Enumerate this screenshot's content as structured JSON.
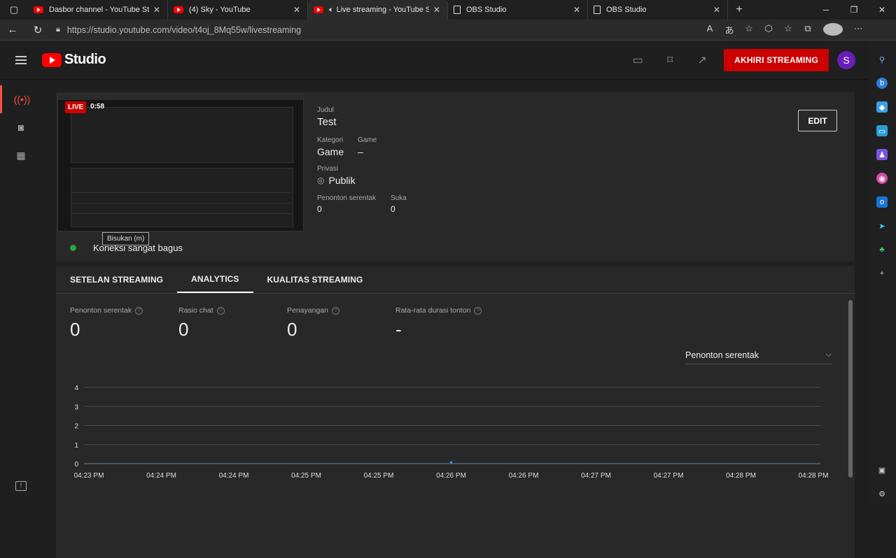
{
  "browser": {
    "tabs": [
      {
        "title": "Dasbor channel - YouTube Studio",
        "icon": "youtube-icon",
        "active": false,
        "audio": false
      },
      {
        "title": "(4) Sky - YouTube",
        "icon": "youtube-icon",
        "active": false,
        "audio": false
      },
      {
        "title": "Live streaming - YouTube Studio",
        "icon": "youtube-icon",
        "active": true,
        "audio": true
      },
      {
        "title": "OBS Studio",
        "icon": "document-icon",
        "active": false,
        "audio": false
      },
      {
        "title": "OBS Studio",
        "icon": "document-icon",
        "active": false,
        "audio": false
      }
    ],
    "url": "https://studio.youtube.com/video/t4oj_8Mq55w/livestreaming"
  },
  "studio": {
    "logo_text": "Studio",
    "end_stream_label": "AKHIRI STREAMING",
    "user_initial": "S",
    "accent": "#cc0000"
  },
  "stream": {
    "live_label": "LIVE",
    "elapsed": "0:58",
    "tooltip": "Bisukan (m)",
    "connection": "Koneksi sangat bagus",
    "title_label": "Judul",
    "title": "Test",
    "category_label": "Kategori",
    "category": "Game",
    "game_label": "Game",
    "game": "–",
    "privacy_label": "Privasi",
    "privacy": "Publik",
    "viewers_label": "Penonton serentak",
    "viewers": "0",
    "likes_label": "Suka",
    "likes": "0",
    "edit_label": "EDIT"
  },
  "tabs": [
    "SETELAN STREAMING",
    "ANALYTICS",
    "KUALITAS STREAMING"
  ],
  "metrics": [
    {
      "label": "Penonton serentak",
      "value": "0"
    },
    {
      "label": "Rasio chat",
      "value": "0"
    },
    {
      "label": "Penayangan",
      "value": "0"
    },
    {
      "label": "Rata-rata durasi tonton",
      "value": "-"
    }
  ],
  "metric_select": "Penonton serentak",
  "chart_data": {
    "type": "line",
    "x": [
      "04:23 PM",
      "04:24 PM",
      "04:24 PM",
      "04:25 PM",
      "04:25 PM",
      "04:26 PM",
      "04:26 PM",
      "04:27 PM",
      "04:27 PM",
      "04:28 PM",
      "04:28 PM"
    ],
    "series": [
      {
        "values": [
          0,
          0,
          0,
          0,
          0,
          0,
          0,
          0,
          0,
          0,
          0
        ]
      }
    ],
    "y_ticks": [
      0,
      1,
      2,
      3,
      4
    ],
    "ylim": [
      0,
      4
    ],
    "grid": true
  }
}
